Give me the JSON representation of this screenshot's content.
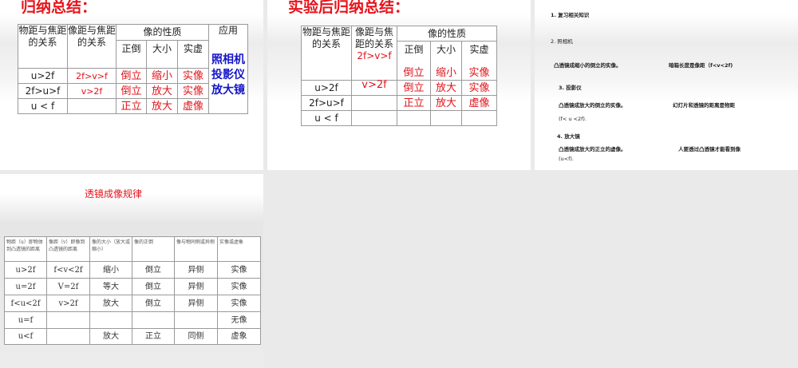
{
  "slides": [
    {
      "title": "归纳总结：",
      "header": {
        "obj": "物距与焦距的关系",
        "img": "像距与焦距的关系",
        "nature": "像的性质",
        "orient": "正倒",
        "size": "大小",
        "real": "实虚",
        "app": "应用"
      },
      "apps": [
        "照相机",
        "投影仪",
        "放大镜"
      ],
      "rows": [
        [
          "u>2f",
          "2f>v>f",
          "倒立",
          "缩小",
          "实像"
        ],
        [
          "2f>u>f",
          "v>2f",
          "倒立",
          "放大",
          "实像"
        ],
        [
          "u < f",
          "",
          "正立",
          "放大",
          "虚像"
        ]
      ]
    },
    {
      "title": "实验后归纳总结：",
      "header": {
        "obj": "物距与焦距的关系",
        "img": "像距与焦距的关系",
        "nature": "像的性质",
        "orient": "正倒",
        "size": "大小",
        "real": "实虚"
      },
      "answers": [
        [
          "2f>v>f",
          "倒立",
          "缩小",
          "实像"
        ],
        [
          "v>2f",
          "倒立",
          "放大",
          "实像"
        ],
        [
          "",
          "正立",
          "放大",
          "虚像"
        ]
      ],
      "rows": [
        "u>2f",
        "2f>u>f",
        "u < f"
      ]
    },
    {
      "lines": [
        "1. 复习相关知识",
        "2. 照相机",
        "凸透镜成缩小的倒立的实像。",
        "暗箱长度是像距（f<v<2f)",
        "3. 投影仪",
        "凸透镜成放大的倒立的实像。",
        "幻灯片和透镜的距离是物距",
        "(f< u <2f).",
        "4. 放大镜",
        "凸透镜成放大的正立的虚像。",
        "人要透过凸透镜才能看到像",
        "(u<f)."
      ]
    },
    {
      "title": "透镜成像规律",
      "header": [
        "物距（u）即物体到凸透镜的距离",
        "像距（v）即像到凸透镜的距离",
        "像的大小（放大或缩小）",
        "像的正倒",
        "像与物同侧或异侧",
        "实像或虚象"
      ],
      "rows": [
        [
          "u>2f",
          "f<v<2f",
          "缩小",
          "倒立",
          "异侧",
          "实像"
        ],
        [
          "u=2f",
          "V=2f",
          "等大",
          "倒立",
          "异侧",
          "实像"
        ],
        [
          "f<u<2f",
          "v>2f",
          "放大",
          "倒立",
          "异侧",
          "实像"
        ],
        [
          "u=f",
          "",
          "",
          "",
          "",
          "无像"
        ],
        [
          "u<f",
          "",
          "放大",
          "正立",
          "同侧",
          "虚象"
        ]
      ]
    }
  ]
}
